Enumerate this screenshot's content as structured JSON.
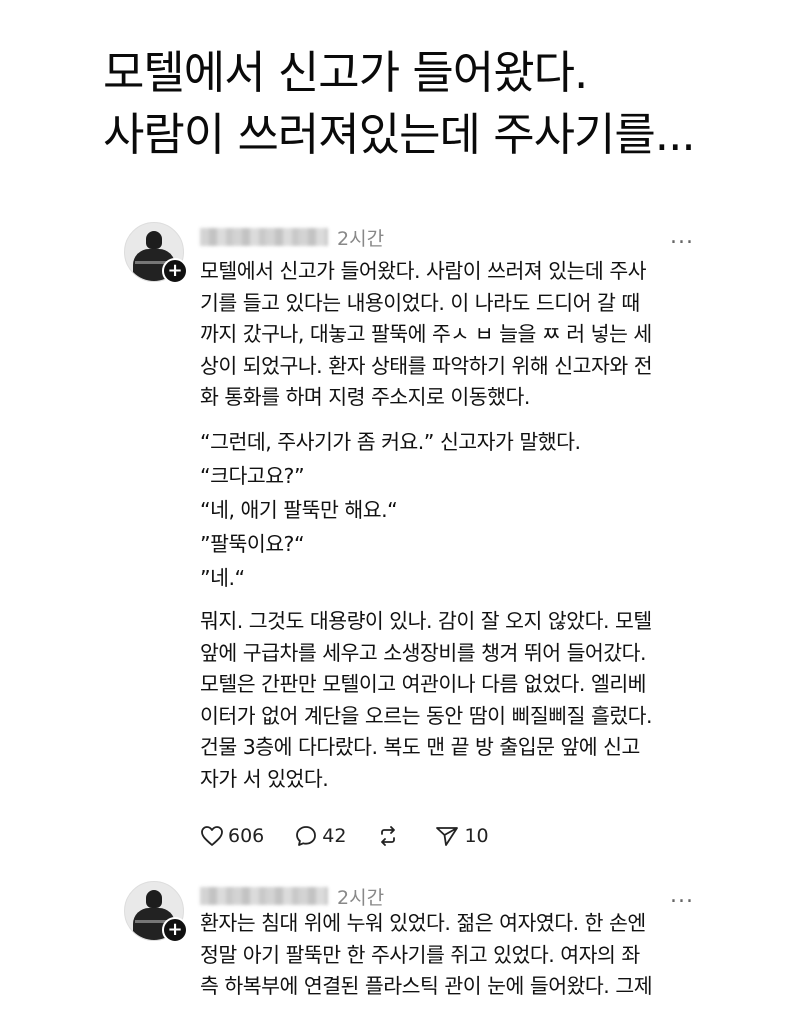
{
  "headline": {
    "line1": "모텔에서 신고가 들어왔다.",
    "line2": "사람이 쓰러져있는데 주사기를..."
  },
  "posts": [
    {
      "time": "2시간",
      "more": "...",
      "paragraphs": [
        [
          "모텔에서 신고가 들어왔다. 사람이 쓰러져 있는데 주사",
          "기를 들고 있다는 내용이었다. 이 나라도 드디어 갈 때",
          "까지 갔구나, 대놓고 팔뚝에 주ㅅ ㅂ 늘을 ㅉ 러 넣는 세",
          "상이 되었구나. 환자 상태를 파악하기 위해 신고자와 전",
          "화 통화를 하며 지령 주소지로 이동했다."
        ],
        [
          "“그런데, 주사기가 좀 커요.” 신고자가 말했다.",
          "“크다고요?”",
          "“네, 애기 팔뚝만 해요.“",
          "”팔뚝이요?“",
          "”네.“"
        ],
        [
          "뭐지. 그것도 대용량이 있나. 감이 잘 오지 않았다. 모텔",
          "앞에 구급차를 세우고 소생장비를 챙겨 뛰어 들어갔다.",
          "모텔은 간판만 모텔이고 여관이나 다름 없었다. 엘리베",
          "이터가 없어 계단을 오르는 동안 땀이 삐질삐질 흘렀다.",
          "건물 3층에 다다랐다. 복도 맨 끝 방 출입문 앞에 신고",
          "자가 서 있었다."
        ]
      ],
      "actions": {
        "likes": "606",
        "comments": "42",
        "reposts": "",
        "shares": "10"
      }
    },
    {
      "time": "2시간",
      "more": "...",
      "paragraphs": [
        [
          "환자는 침대 위에 누워 있었다. 젊은 여자였다. 한 손엔",
          "정말 아기 팔뚝만 한 주사기를 쥐고 있었다. 여자의 좌",
          "측 하복부에 연결된 플라스틱 관이 눈에 들어왔다. 그제"
        ]
      ]
    }
  ]
}
